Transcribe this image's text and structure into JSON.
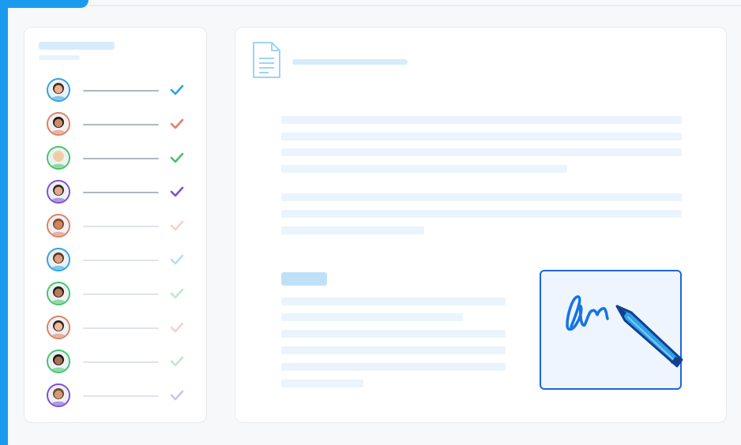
{
  "colors": {
    "accent": "#1a9bf0",
    "placeholder_light": "#eaf4fd",
    "placeholder_mid": "#d6ecfb",
    "label_tag": "#bfe1f8",
    "signature_border": "#1d67d8",
    "signature_fill": "#eef5fe"
  },
  "signers_panel": {
    "signers": [
      {
        "avatar_color": "#2ba3e6",
        "check_color": "#2ba3e6",
        "status": "signed"
      },
      {
        "avatar_color": "#e07f62",
        "check_color": "#e07f62",
        "status": "signed"
      },
      {
        "avatar_color": "#43c46a",
        "check_color": "#43c46a",
        "status": "signed"
      },
      {
        "avatar_color": "#7b4fd6",
        "check_color": "#7b4fd6",
        "status": "signed"
      },
      {
        "avatar_color": "#e07f62",
        "check_color": "#e07f62",
        "status": "pending"
      },
      {
        "avatar_color": "#2ba3e6",
        "check_color": "#2ba3e6",
        "status": "pending"
      },
      {
        "avatar_color": "#43c46a",
        "check_color": "#43c46a",
        "status": "pending"
      },
      {
        "avatar_color": "#e07f62",
        "check_color": "#e07f62",
        "status": "pending"
      },
      {
        "avatar_color": "#43c46a",
        "check_color": "#43c46a",
        "status": "pending"
      },
      {
        "avatar_color": "#7b4fd6",
        "check_color": "#7b4fd6",
        "status": "pending"
      }
    ]
  },
  "document": {
    "icon": "document-icon",
    "signature_icon": "pen-icon"
  }
}
